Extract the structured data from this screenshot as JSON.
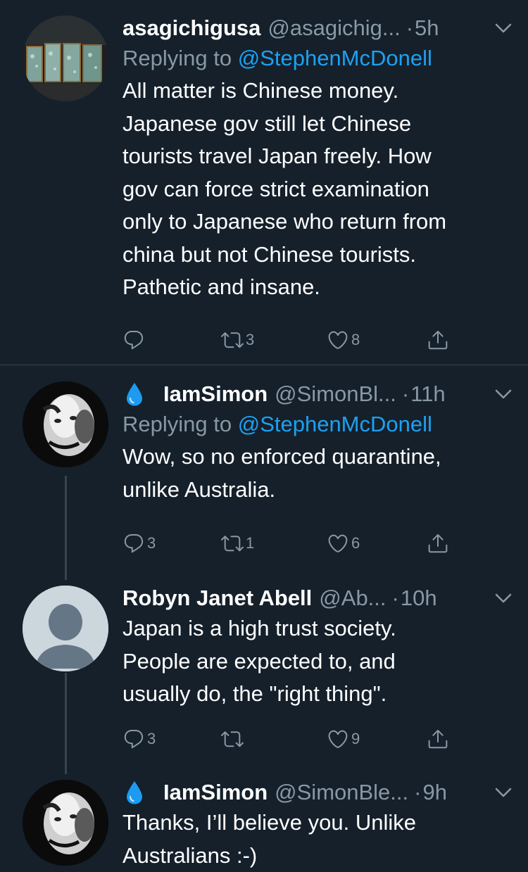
{
  "tweets": [
    {
      "name": "asagichigusa",
      "handle": "@asagichig...",
      "dot": "·",
      "time": "5h",
      "reply_prefix": "Replying to ",
      "reply_mention": "@StephenMcDonell",
      "lines": [
        "All matter is Chinese money.",
        "Japanese gov still let Chinese",
        "tourists travel Japan freely. How",
        "gov can force strict examination",
        "only to Japanese who return from",
        "china but not Chinese tourists.",
        "Pathetic and  insane."
      ],
      "replies": "",
      "retweets": "3",
      "likes": "8"
    },
    {
      "name": "IamSimon",
      "handle": "@SimonBl...",
      "dot": "·",
      "time": "11h",
      "reply_prefix": "Replying to ",
      "reply_mention": "@StephenMcDonell",
      "lines": [
        "Wow, so no enforced quarantine,",
        "unlike Australia."
      ],
      "replies": "3",
      "retweets": "1",
      "likes": "6"
    },
    {
      "name": "Robyn Janet Abell",
      "handle": "@Ab...",
      "dot": "·",
      "time": "10h",
      "lines": [
        "Japan is a high trust society.",
        "People are expected to, and",
        "usually do, the \"right thing\"."
      ],
      "replies": "3",
      "retweets": "",
      "likes": "9"
    },
    {
      "name": "IamSimon",
      "handle": "@SimonBle...",
      "dot": "·",
      "time": "9h",
      "lines": [
        "Thanks, I’ll believe you.  Unlike",
        "Australians :-)"
      ]
    }
  ],
  "icons": {
    "reply": "reply-icon",
    "retweet": "retweet-icon",
    "like": "heart-icon",
    "share": "share-icon",
    "more": "chevron-down-icon",
    "emoji": "droplet-icon"
  },
  "colors": {
    "background": "#15202b",
    "text": "#ffffff",
    "secondary": "#8899a6",
    "link": "#1da1f2",
    "divider": "#38444d"
  }
}
